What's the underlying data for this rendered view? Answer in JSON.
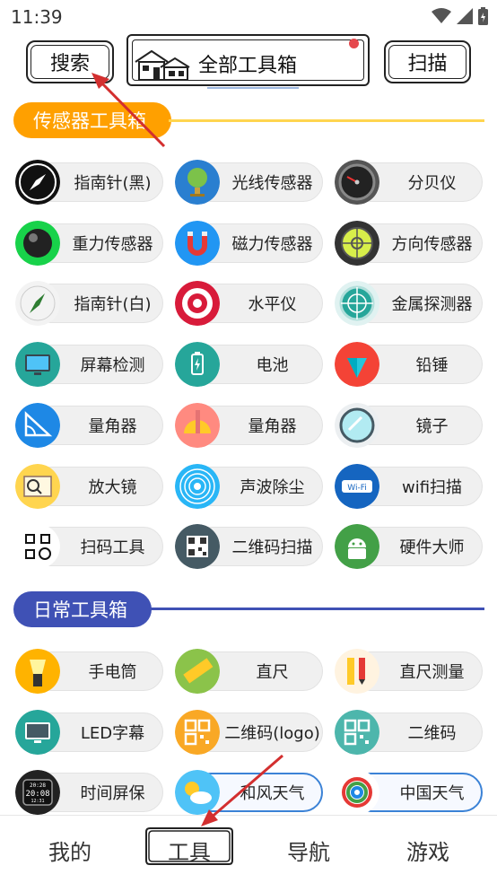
{
  "status_bar": {
    "time": "11:39"
  },
  "header": {
    "search_label": "搜索",
    "title": "全部工具箱",
    "scan_label": "扫描"
  },
  "sections": [
    {
      "label": "传感器工具箱",
      "color": "#ffa000",
      "line_color": "#ffd54f"
    },
    {
      "label": "日常工具箱",
      "color": "#3f51b5",
      "line_color": "#3f51b5"
    }
  ],
  "sensor_tools": [
    {
      "label": "指南针(黑)",
      "icon": "compass-black-icon"
    },
    {
      "label": "光线传感器",
      "icon": "light-globe-icon"
    },
    {
      "label": "分贝仪",
      "icon": "decibel-meter-icon"
    },
    {
      "label": "重力传感器",
      "icon": "gravity-ball-icon"
    },
    {
      "label": "磁力传感器",
      "icon": "magnet-icon"
    },
    {
      "label": "方向传感器",
      "icon": "level-bubble-icon"
    },
    {
      "label": "指南针(白)",
      "icon": "compass-white-icon"
    },
    {
      "label": "水平仪",
      "icon": "target-level-icon"
    },
    {
      "label": "金属探测器",
      "icon": "radar-icon"
    },
    {
      "label": "屏幕检测",
      "icon": "monitor-icon"
    },
    {
      "label": "电池",
      "icon": "battery-icon"
    },
    {
      "label": "铅锤",
      "icon": "plumb-icon"
    },
    {
      "label": "量角器",
      "icon": "protractor-icon"
    },
    {
      "label": "量角器",
      "icon": "protractor-pencil-icon"
    },
    {
      "label": "镜子",
      "icon": "mirror-icon"
    },
    {
      "label": "放大镜",
      "icon": "magnifier-book-icon"
    },
    {
      "label": "声波除尘",
      "icon": "sound-wave-icon"
    },
    {
      "label": "wifi扫描",
      "icon": "wifi-icon"
    },
    {
      "label": "扫码工具",
      "icon": "scan-code-icon"
    },
    {
      "label": "二维码扫描",
      "icon": "qr-scan-icon"
    },
    {
      "label": "硬件大师",
      "icon": "android-icon"
    }
  ],
  "daily_tools": [
    {
      "label": "手电筒",
      "icon": "flashlight-icon"
    },
    {
      "label": "直尺",
      "icon": "ruler-icon"
    },
    {
      "label": "直尺测量",
      "icon": "ruler-pencil-icon"
    },
    {
      "label": "LED字幕",
      "icon": "led-monitor-icon"
    },
    {
      "label": "二维码(logo)",
      "icon": "qr-logo-icon"
    },
    {
      "label": "二维码",
      "icon": "qr-code-icon"
    },
    {
      "label": "时间屏保",
      "icon": "clock-screen-icon"
    },
    {
      "label": "和风天气",
      "icon": "weather-icon"
    },
    {
      "label": "中国天气",
      "icon": "china-weather-icon"
    }
  ],
  "clock_icon_text": {
    "top": "20:28",
    "mid": "20:08",
    "bot": "12:31"
  },
  "wifi_icon_text": "Wi-Fi",
  "bottom_nav": [
    {
      "label": "我的"
    },
    {
      "label": "工具"
    },
    {
      "label": "导航"
    },
    {
      "label": "游戏"
    }
  ]
}
